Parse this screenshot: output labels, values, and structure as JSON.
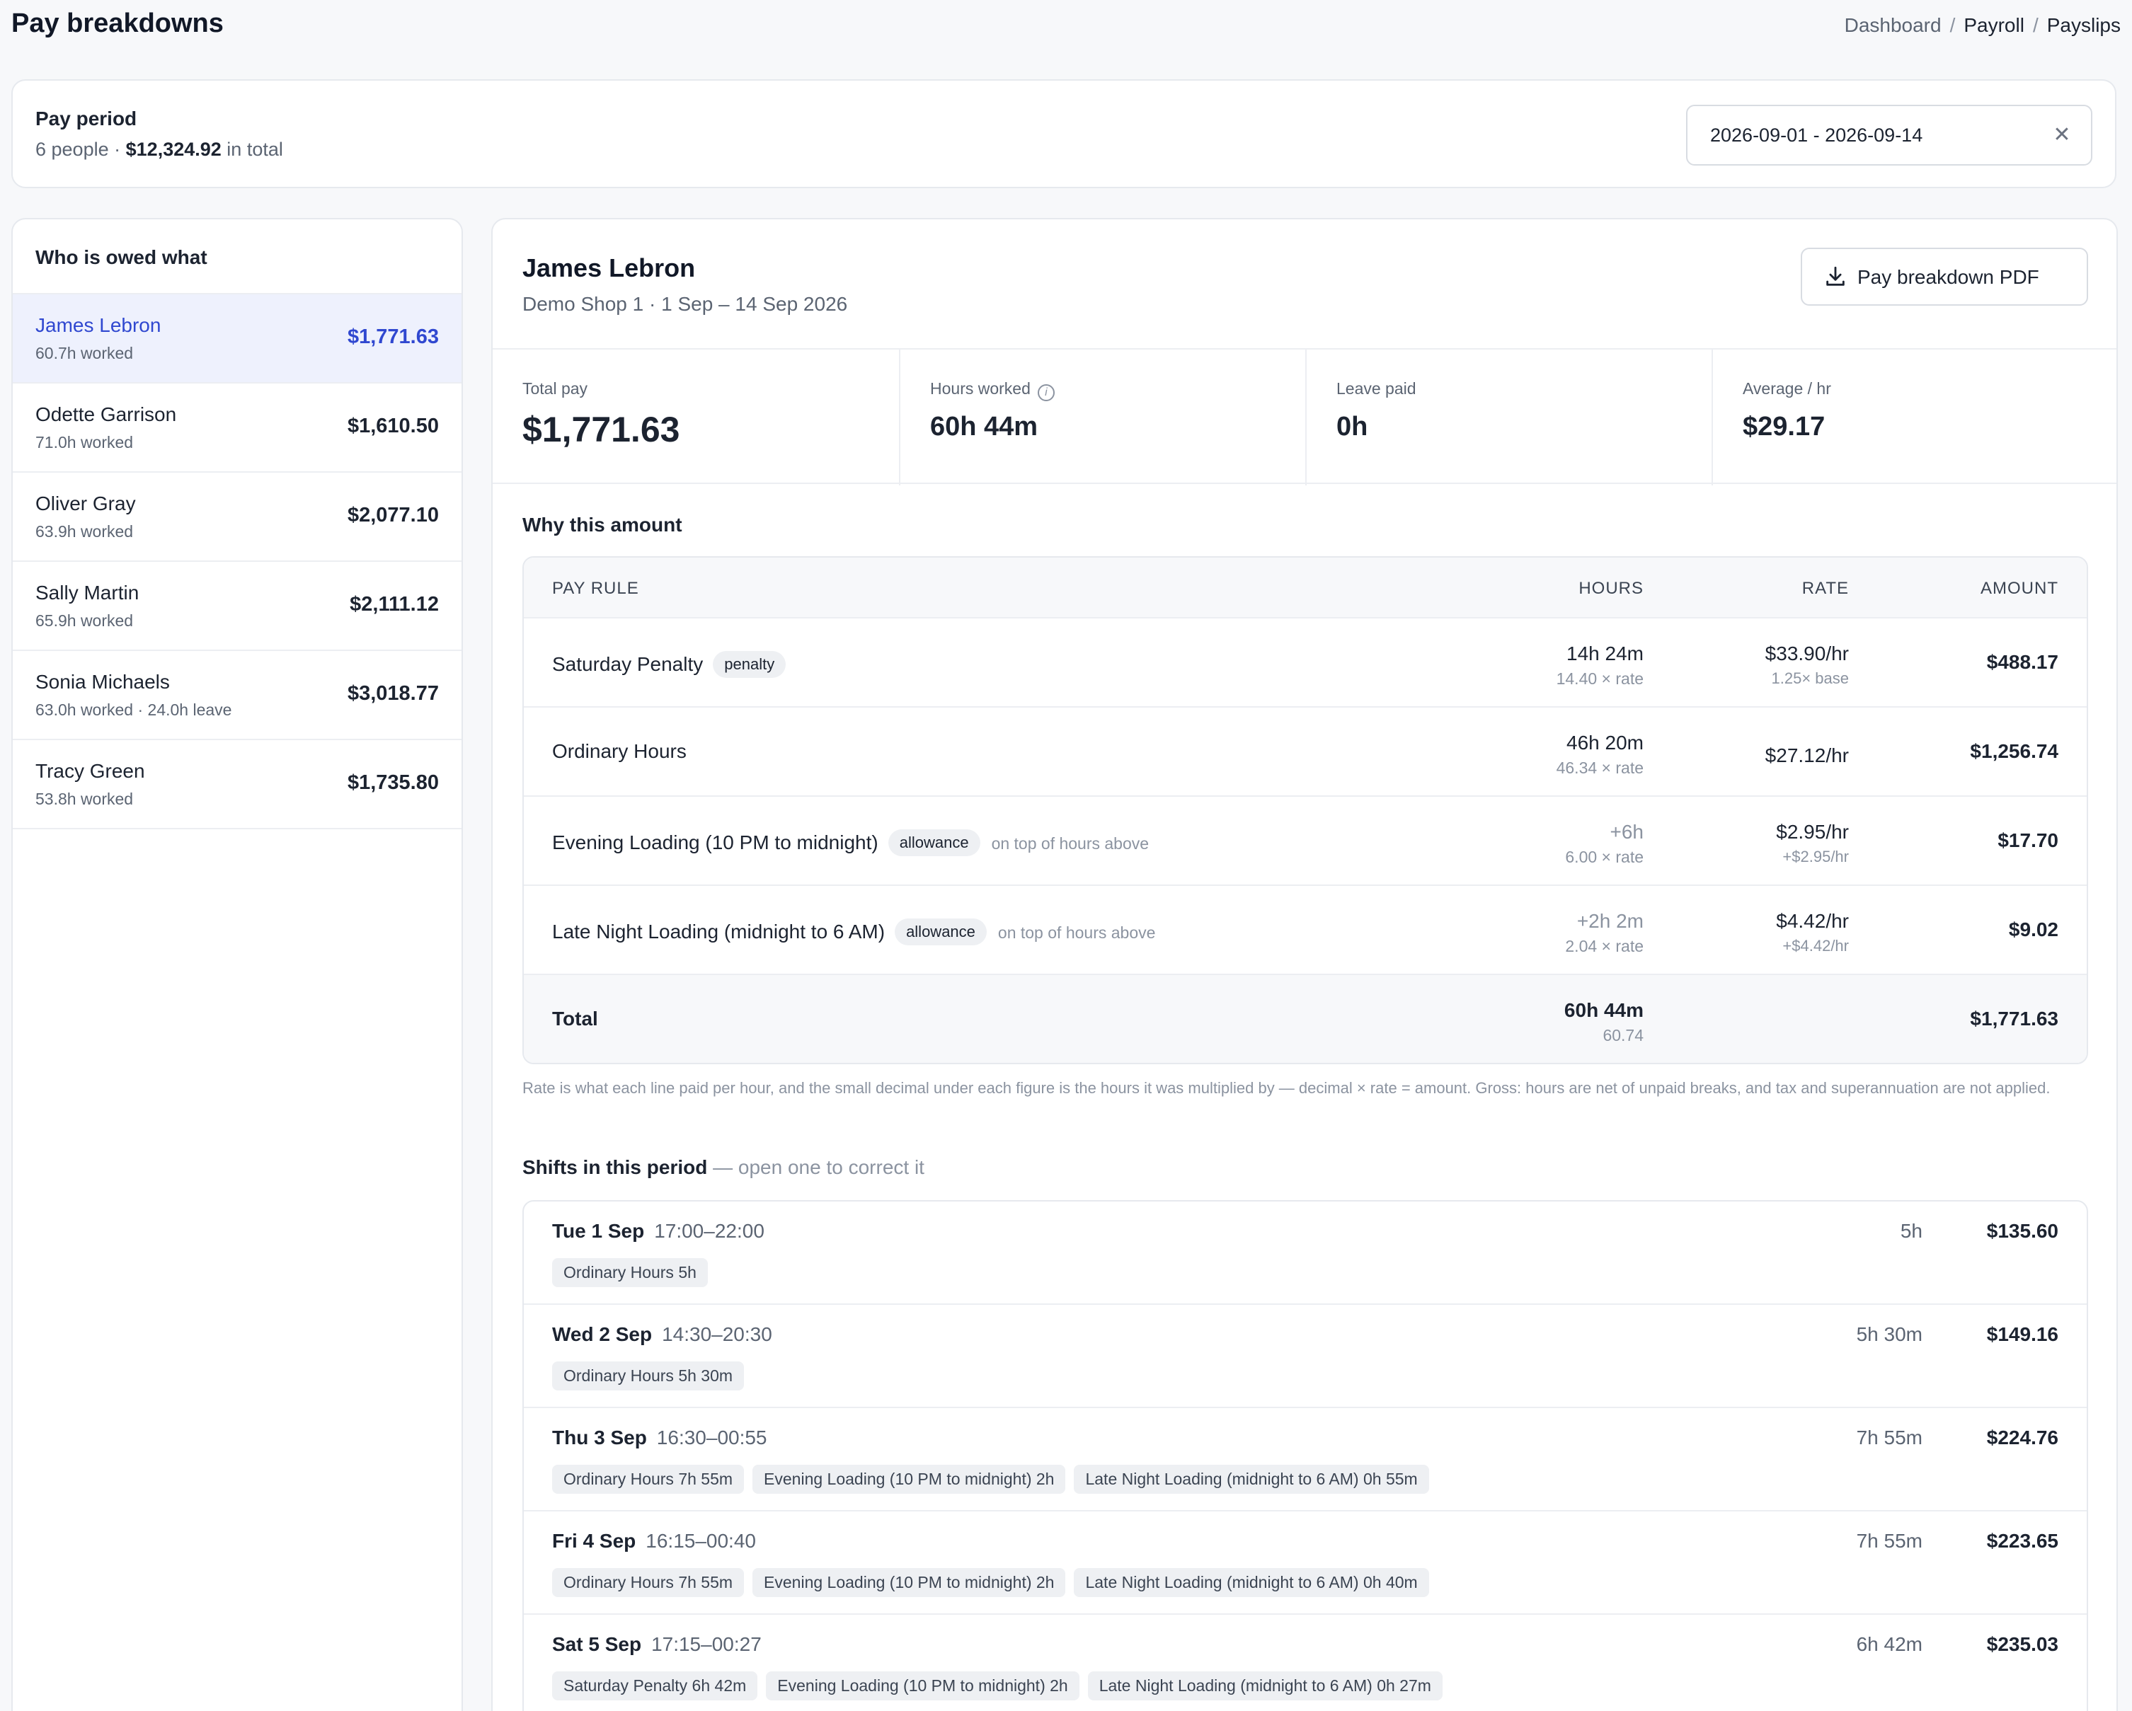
{
  "page": {
    "title": "Pay breakdowns"
  },
  "breadcrumb": [
    "Dashboard",
    "Payroll",
    "Payslips"
  ],
  "pay_period": {
    "label": "Pay period",
    "people": "6 people",
    "sep": "·",
    "total_amount": "$12,324.92",
    "total_suffix": "in total",
    "date_range": "2026-09-01 - 2026-09-14",
    "clear_icon": "close-icon"
  },
  "people_list": {
    "heading": "Who is owed what",
    "items": [
      {
        "name": "James Lebron",
        "hours": "60.7h worked",
        "amount": "$1,771.63",
        "active": true
      },
      {
        "name": "Odette Garrison",
        "hours": "71.0h worked",
        "amount": "$1,610.50"
      },
      {
        "name": "Oliver Gray",
        "hours": "63.9h worked",
        "amount": "$2,077.10"
      },
      {
        "name": "Sally Martin",
        "hours": "65.9h worked",
        "amount": "$2,111.12"
      },
      {
        "name": "Sonia Michaels",
        "hours": "63.0h worked · 24.0h leave",
        "amount": "$3,018.77"
      },
      {
        "name": "Tracy Green",
        "hours": "53.8h worked",
        "amount": "$1,735.80"
      }
    ]
  },
  "detail": {
    "name": "James Lebron",
    "subtitle": "Demo Shop 1 · 1 Sep – 14 Sep 2026",
    "pdf_button": "Pay breakdown PDF",
    "pdf_icon": "download-icon",
    "stats": [
      {
        "label": "Total pay",
        "value": "$1,771.63"
      },
      {
        "label": "Hours worked",
        "value": "60h 44m",
        "icon": "info-icon"
      },
      {
        "label": "Leave paid",
        "value": "0h"
      },
      {
        "label": "Average / hr",
        "value": "$29.17"
      }
    ],
    "why_heading": "Why this amount",
    "table": {
      "headers": {
        "rule": "PAY RULE",
        "hours": "HOURS",
        "rate": "RATE",
        "amount": "AMOUNT"
      },
      "rows": [
        {
          "rule": "Saturday Penalty",
          "tag": "penalty",
          "note": "",
          "hours": "14h 24m",
          "hours_sub": "14.40 × rate",
          "rate": "$33.90/hr",
          "rate_sub": "1.25× base",
          "amount": "$488.17"
        },
        {
          "rule": "Ordinary Hours",
          "tag": "",
          "note": "",
          "hours": "46h 20m",
          "hours_sub": "46.34 × rate",
          "rate": "$27.12/hr",
          "rate_sub": "",
          "amount": "$1,256.74"
        },
        {
          "rule": "Evening Loading (10 PM to midnight)",
          "tag": "allowance",
          "note": "on top of hours above",
          "hours": "+6h",
          "hours_sub": "6.00 × rate",
          "rate": "$2.95/hr",
          "rate_sub": "+$2.95/hr",
          "amount": "$17.70"
        },
        {
          "rule": "Late Night Loading (midnight to 6 AM)",
          "tag": "allowance",
          "note": "on top of hours above",
          "hours": "+2h 2m",
          "hours_sub": "2.04 × rate",
          "rate": "$4.42/hr",
          "rate_sub": "+$4.42/hr",
          "amount": "$9.02"
        }
      ],
      "total": {
        "label": "Total",
        "hours": "60h 44m",
        "hours_sub": "60.74",
        "amount": "$1,771.63"
      }
    },
    "footnote": "Rate is what each line paid per hour, and the small decimal under each figure is the hours it was multiplied by — decimal × rate = amount. Gross: hours are net of unpaid breaks, and tax and superannuation are not applied.",
    "shifts_heading": "Shifts in this period",
    "shifts_hint": "— open one to correct it",
    "shifts": [
      {
        "day": "Tue 1 Sep",
        "time": "17:00–22:00",
        "hours": "5h",
        "amount": "$135.60",
        "chips": [
          "Ordinary Hours 5h"
        ]
      },
      {
        "day": "Wed 2 Sep",
        "time": "14:30–20:30",
        "hours": "5h 30m",
        "amount": "$149.16",
        "chips": [
          "Ordinary Hours 5h 30m"
        ]
      },
      {
        "day": "Thu 3 Sep",
        "time": "16:30–00:55",
        "hours": "7h 55m",
        "amount": "$224.76",
        "chips": [
          "Ordinary Hours 7h 55m",
          "Evening Loading (10 PM to midnight) 2h",
          "Late Night Loading (midnight to 6 AM) 0h 55m"
        ]
      },
      {
        "day": "Fri 4 Sep",
        "time": "16:15–00:40",
        "hours": "7h 55m",
        "amount": "$223.65",
        "chips": [
          "Ordinary Hours 7h 55m",
          "Evening Loading (10 PM to midnight) 2h",
          "Late Night Loading (midnight to 6 AM) 0h 40m"
        ]
      },
      {
        "day": "Sat 5 Sep",
        "time": "17:15–00:27",
        "hours": "6h 42m",
        "amount": "$235.03",
        "chips": [
          "Saturday Penalty 6h 42m",
          "Evening Loading (10 PM to midnight) 2h",
          "Late Night Loading (midnight to 6 AM) 0h 27m"
        ]
      }
    ]
  },
  "colors": {
    "accent": "#3048d0",
    "active_bg": "#eef1fd",
    "muted": "#8b93a0"
  }
}
